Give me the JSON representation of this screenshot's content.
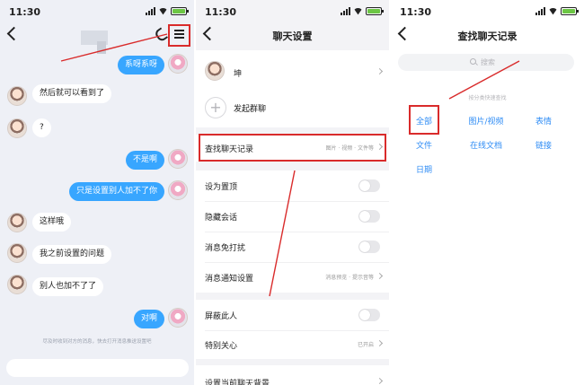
{
  "status": {
    "time": "11:30"
  },
  "chat": {
    "messages": [
      {
        "side": "out",
        "text": "系呀系呀"
      },
      {
        "side": "in",
        "text": "然后就可以看到了"
      },
      {
        "side": "in",
        "text": "?"
      },
      {
        "side": "out",
        "text": "不是啊"
      },
      {
        "side": "out",
        "text": "只是设置别人加不了你"
      },
      {
        "side": "in",
        "text": "这样哦"
      },
      {
        "side": "in",
        "text": "我之前设置的问题"
      },
      {
        "side": "in",
        "text": "别人也加不了了"
      },
      {
        "side": "out",
        "text": "对啊"
      }
    ],
    "notice": "尽及时收到对方的消息，快去打开消息推送设置吧"
  },
  "settings": {
    "title": "聊天设置",
    "contact_name": "坤",
    "group_chat_label": "发起群聊",
    "search_record_label": "查找聊天记录",
    "search_record_value": "图片 · 视频 · 文件等",
    "pin_label": "设为置顶",
    "hide_label": "隐藏会话",
    "mute_label": "消息免打扰",
    "notify_label": "消息通知设置",
    "notify_value": "消息预览 · 提示音等",
    "block_label": "屏蔽此人",
    "special_label": "特别关心",
    "special_value": "已开启",
    "background_label": "设置当前聊天背景"
  },
  "search": {
    "title": "查找聊天记录",
    "placeholder": "搜索",
    "quick_title": "按分类快速查找",
    "categories": [
      "全部",
      "图片/视频",
      "表情",
      "文件",
      "在线文档",
      "链接",
      "日期"
    ]
  },
  "colors": {
    "accent_blue": "#38a6ff",
    "link_blue": "#2f8cf5",
    "highlight_red": "#d92b2b"
  }
}
